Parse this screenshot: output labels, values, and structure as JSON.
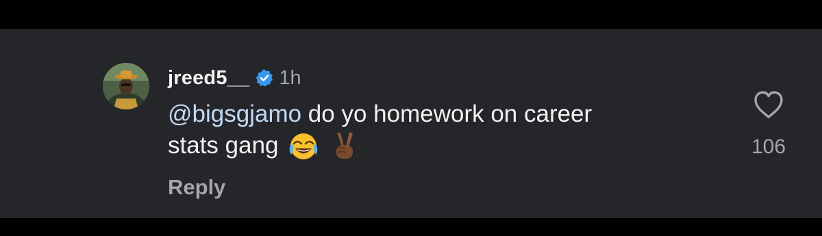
{
  "comment": {
    "username": "jreed5__",
    "verified": true,
    "timestamp": "1h",
    "mention": "@bigsgjamo",
    "text_line1": " do yo homework on career",
    "text_line2": "stats gang",
    "emojis": [
      "face-with-tears-of-joy",
      "victory-hand-medium-dark-skin-tone"
    ],
    "reply_label": "Reply",
    "like_count": "106"
  },
  "colors": {
    "background": "#25262a",
    "outer_background": "#000000",
    "primary_text": "#f2f2f2",
    "secondary_text": "#a4a6ab",
    "mention": "#c3d8f6",
    "verified_badge": "#3897f0"
  },
  "icons": {
    "verified": "verified-badge-icon",
    "like": "heart-outline-icon"
  }
}
